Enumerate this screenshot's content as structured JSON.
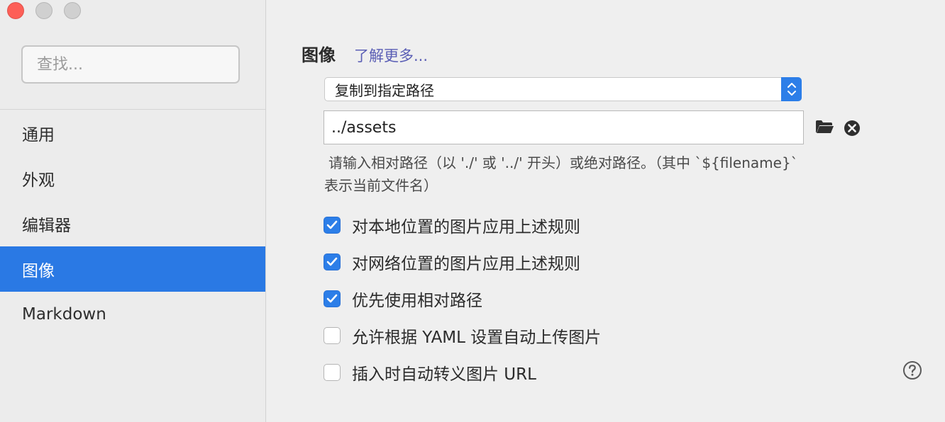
{
  "window": {
    "controls": [
      "close-icon",
      "minimize-icon",
      "zoom-icon"
    ],
    "colors": {
      "close": "#fd5f57",
      "inactive": "#d0d0d0"
    }
  },
  "sidebar": {
    "search_placeholder": "查找...",
    "items": [
      {
        "label": "通用",
        "active": false
      },
      {
        "label": "外观",
        "active": false
      },
      {
        "label": "编辑器",
        "active": false
      },
      {
        "label": "图像",
        "active": true
      },
      {
        "label": "Markdown",
        "active": false
      }
    ],
    "active_color": "#2a79e4"
  },
  "main": {
    "section_title": "图像",
    "learn_more": "了解更多...",
    "action_select": {
      "value": "复制到指定路径",
      "icon": "up-down-chevron-icon"
    },
    "path_input": {
      "value": "../assets"
    },
    "folder_icon": "folder-icon",
    "clear_icon": "close-circle-icon",
    "hint_line1": "请输入相对路径（以 './' 或 '../' 开头）或绝对路径。（其中 `${filename}`",
    "hint_line2": "表示当前文件名）",
    "checkboxes": [
      {
        "label": "对本地位置的图片应用上述规则",
        "checked": true
      },
      {
        "label": "对网络位置的图片应用上述规则",
        "checked": true
      },
      {
        "label": "优先使用相对路径",
        "checked": true
      },
      {
        "label": "允许根据 YAML 设置自动上传图片",
        "checked": false
      },
      {
        "label": "插入时自动转义图片 URL",
        "checked": false
      }
    ],
    "help_icon": "question-circle-icon",
    "accent_color": "#2c7ee8",
    "link_color": "#5a5eb5"
  }
}
